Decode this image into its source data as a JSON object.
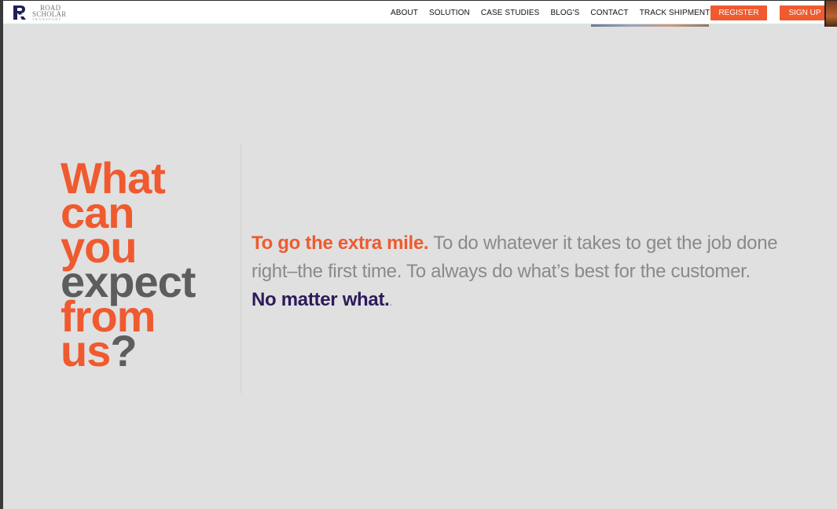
{
  "brand": {
    "logo_line1": "ROAD",
    "logo_line2": "SCHOLAR",
    "logo_line3": "TRANSPORT",
    "accent_color": "#ef5a2f",
    "purple_color": "#2d1a5a"
  },
  "nav": {
    "items": [
      "ABOUT",
      "SOLUTION",
      "CASE STUDIES",
      "BLOG'S",
      "CONTACT",
      "TRACK SHIPMENT"
    ],
    "register_label": "REGISTER",
    "signup_label": "SIGN UP"
  },
  "hero": {
    "headline": {
      "w1": "What",
      "w2": "can",
      "w3": "you",
      "w4": "expect",
      "w5": "from",
      "w6": "us",
      "qmark": "?"
    },
    "lead_accent": "To go the extra mile.",
    "lead_body": " To do whatever it takes to get the job done right–the first time. To always do what’s best for the customer.",
    "closing": "No matter what.",
    "closing_dot": "."
  }
}
